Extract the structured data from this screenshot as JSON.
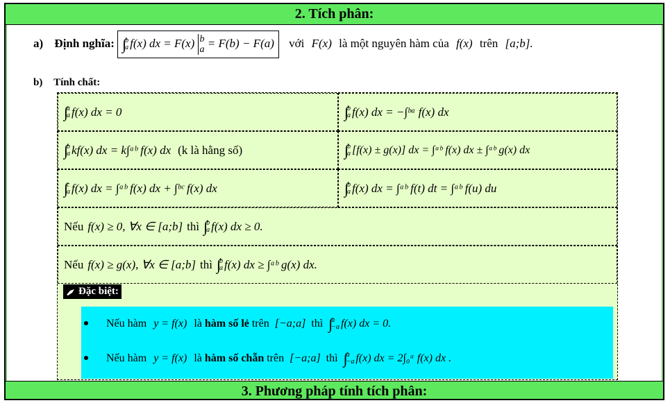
{
  "header": {
    "title": "2. Tích phân:"
  },
  "definition": {
    "marker": "a)",
    "label": "Định nghĩa:",
    "formula_left": "f(x) dx = F(x)",
    "formula_right": "= F(b) − F(a)",
    "upper": "b",
    "lower": "a",
    "eval_upper": "b",
    "eval_lower": "a",
    "tail_1": "với",
    "tail_fx": "F(x)",
    "tail_2": "là một nguyên hàm của",
    "tail_f": "f(x)",
    "tail_3": "trên",
    "tail_interval": "[a;b]."
  },
  "properties": {
    "marker": "b)",
    "label": "Tính chất:",
    "cells": [
      {
        "pre": "",
        "formula": "f(x) dx = 0",
        "up": "a",
        "lo": "a"
      },
      {
        "pre": "",
        "formula": "f(x) dx = −∫ᵇᵃ f(x) dx",
        "up": "b",
        "lo": "a"
      },
      {
        "pre": "",
        "formula": "kf(x) dx = k∫ᵃᵇ f(x) dx",
        "up": "b",
        "lo": "a",
        "note": "(k là hằng số)"
      },
      {
        "pre": "",
        "formula": "[f(x) ± g(x)] dx = ∫ᵃᵇ f(x) dx ± ∫ᵃᵇ g(x) dx",
        "up": "b",
        "lo": "a"
      },
      {
        "pre": "",
        "formula": "f(x) dx = ∫ᵃᵇ f(x) dx + ∫ᵇᶜ f(x) dx",
        "up": "c",
        "lo": "a"
      },
      {
        "pre": "",
        "formula": "f(x) dx = ∫ᵃᵇ f(t) dt = ∫ᵃᵇ f(u) du",
        "up": "b",
        "lo": "a"
      }
    ],
    "row4": {
      "text1": "Nếu",
      "cond": "f(x) ≥ 0, ∀x ∈ [a;b]",
      "text2": "thì",
      "formula": "f(x) dx ≥ 0.",
      "up": "b",
      "lo": "a"
    },
    "row5": {
      "text1": "Nếu",
      "cond": "f(x) ≥ g(x), ∀x ∈ [a;b]",
      "text2": "thì",
      "formula": "f(x) dx ≥ ∫ᵃᵇ g(x) dx.",
      "up": "b",
      "lo": "a"
    }
  },
  "special": {
    "title": "Đặc biệt:",
    "bullets": [
      {
        "t1": "Nếu hàm",
        "expr": "y = f(x)",
        "t2": "là",
        "bold": "hàm số lẻ",
        "t3": "trên",
        "interval": "[−a;a]",
        "t4": "thì",
        "formula": "f(x) dx = 0.",
        "up": "a",
        "lo": "−a"
      },
      {
        "t1": "Nếu hàm",
        "expr": "y = f(x)",
        "t2": "là",
        "bold": "hàm số chẵn",
        "t3": "trên",
        "interval": "[−a;a]",
        "t4": "thì",
        "formula": "f(x) dx = 2∫₀ᵃ f(x) dx .",
        "up": "a",
        "lo": "−a"
      }
    ]
  },
  "footer": {
    "title": "3. Phương pháp tính tích phân:"
  }
}
